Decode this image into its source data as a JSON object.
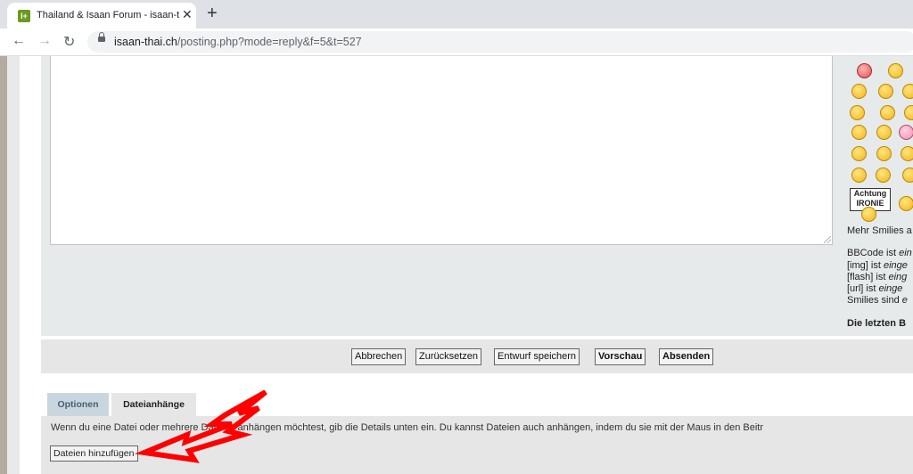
{
  "browser": {
    "tab_title": "Thailand & Isaan Forum - isaan-t",
    "favicon_letter": "I+",
    "url_domain": "isaan-thai.ch",
    "url_path": "/posting.php?mode=reply&f=5&t=527"
  },
  "sidebar": {
    "sign_text": "Achtung IRONIE",
    "more_smilies": "Mehr Smilies a",
    "bbcode_lines": [
      {
        "label": "BBCode ist ",
        "value": "ein"
      },
      {
        "label": "[img] ist ",
        "value": "einge"
      },
      {
        "label": "[flash] ist ",
        "value": "eing"
      },
      {
        "label": "[url] ist ",
        "value": "einge"
      },
      {
        "label": "Smilies sind ",
        "value": "e"
      }
    ],
    "recent_heading": "Die letzten B"
  },
  "actions": {
    "cancel": "Abbrechen",
    "reset": "Zurücksetzen",
    "save_draft": "Entwurf speichern",
    "preview": "Vorschau",
    "submit": "Absenden"
  },
  "panel_tabs": {
    "options": "Optionen",
    "attachments": "Dateianhänge"
  },
  "attachments": {
    "info_text": "Wenn du eine Datei oder mehrere Dateien anhängen möchtest, gib die Details unten ein. Du kannst Dateien auch anhängen, indem du sie mit der Maus in den Beitr",
    "add_files": "Dateien hinzufügen"
  },
  "colors": {
    "arrow": "#ff0000",
    "panel_bg": "#e6eaeb",
    "tab_inactive": "#c9d6df"
  }
}
